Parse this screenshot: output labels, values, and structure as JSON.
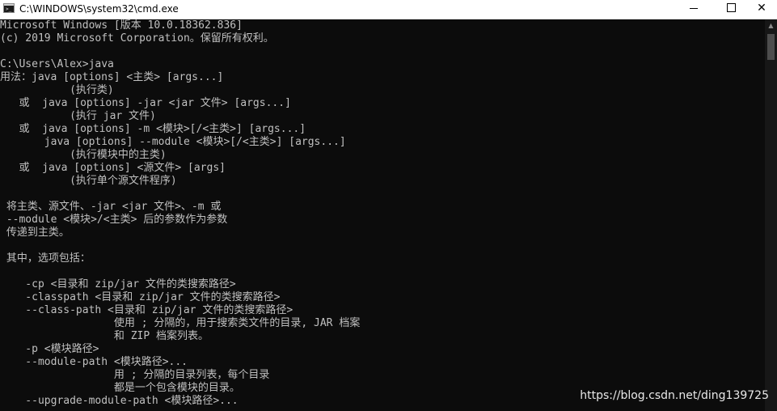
{
  "window": {
    "title": "C:\\WINDOWS\\system32\\cmd.exe",
    "min_symbol": "",
    "max_symbol": "",
    "close_symbol": "✕"
  },
  "console": {
    "lines": [
      "Microsoft Windows [版本 10.0.18362.836]",
      "(c) 2019 Microsoft Corporation。保留所有权利。",
      "",
      "C:\\Users\\Alex>java",
      "用法：java [options] <主类> [args...]",
      "           (执行类)",
      "   或  java [options] -jar <jar 文件> [args...]",
      "           (执行 jar 文件)",
      "   或  java [options] -m <模块>[/<主类>] [args...]",
      "       java [options] --module <模块>[/<主类>] [args...]",
      "           (执行模块中的主类)",
      "   或  java [options] <源文件> [args]",
      "           (执行单个源文件程序)",
      "",
      " 将主类、源文件、-jar <jar 文件>、-m 或",
      " --module <模块>/<主类> 后的参数作为参数",
      " 传递到主类。",
      "",
      " 其中，选项包括：",
      "",
      "    -cp <目录和 zip/jar 文件的类搜索路径>",
      "    -classpath <目录和 zip/jar 文件的类搜索路径>",
      "    --class-path <目录和 zip/jar 文件的类搜索路径>",
      "                  使用 ; 分隔的，用于搜索类文件的目录, JAR 档案",
      "                  和 ZIP 档案列表。",
      "    -p <模块路径>",
      "    --module-path <模块路径>...",
      "                  用 ; 分隔的目录列表，每个目录",
      "                  都是一个包含模块的目录。",
      "    --upgrade-module-path <模块路径>..."
    ]
  },
  "scrollbar": {
    "up_arrow": "▲"
  },
  "watermark": "https://blog.csdn.net/ding139725"
}
